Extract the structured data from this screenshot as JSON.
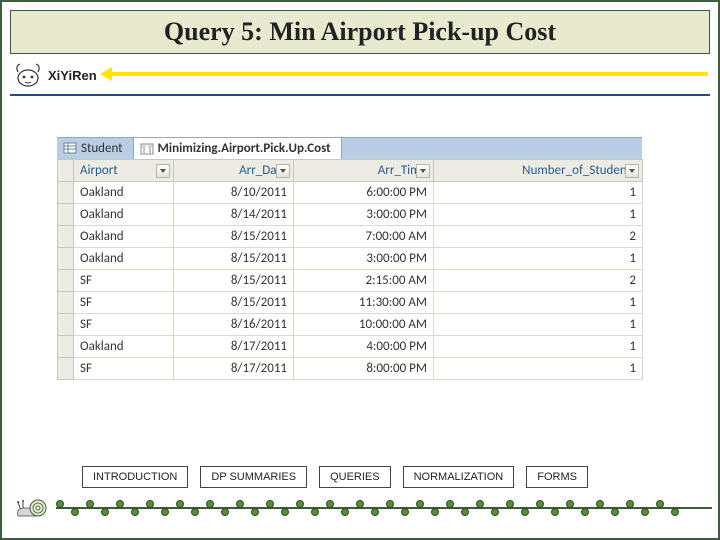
{
  "title": "Query 5: Min Airport Pick-up Cost",
  "brand": "XiYiRen",
  "tabs": [
    {
      "label": "Student",
      "active": false
    },
    {
      "label": "Minimizing.Airport.Pick.Up.Cost",
      "active": true
    }
  ],
  "columns": [
    {
      "label": "Airport",
      "align": "left"
    },
    {
      "label": "Arr_Date",
      "align": "right"
    },
    {
      "label": "Arr_Time",
      "align": "right"
    },
    {
      "label": "Number_of_Students",
      "align": "right"
    }
  ],
  "rows": [
    {
      "airport": "Oakland",
      "date": "8/10/2011",
      "time": "6:00:00 PM",
      "num": "1"
    },
    {
      "airport": "Oakland",
      "date": "8/14/2011",
      "time": "3:00:00 PM",
      "num": "1"
    },
    {
      "airport": "Oakland",
      "date": "8/15/2011",
      "time": "7:00:00 AM",
      "num": "2"
    },
    {
      "airport": "Oakland",
      "date": "8/15/2011",
      "time": "3:00:00 PM",
      "num": "1"
    },
    {
      "airport": "SF",
      "date": "8/15/2011",
      "time": "2:15:00 AM",
      "num": "2"
    },
    {
      "airport": "SF",
      "date": "8/15/2011",
      "time": "11:30:00 AM",
      "num": "1"
    },
    {
      "airport": "SF",
      "date": "8/16/2011",
      "time": "10:00:00 AM",
      "num": "1"
    },
    {
      "airport": "Oakland",
      "date": "8/17/2011",
      "time": "4:00:00 PM",
      "num": "1"
    },
    {
      "airport": "SF",
      "date": "8/17/2011",
      "time": "8:00:00 PM",
      "num": "1"
    }
  ],
  "nav": {
    "introduction": "INTRODUCTION",
    "dp_summaries": "DP SUMMARIES",
    "queries": "QUERIES",
    "normalization": "NORMALIZATION",
    "forms": "FORMS"
  }
}
